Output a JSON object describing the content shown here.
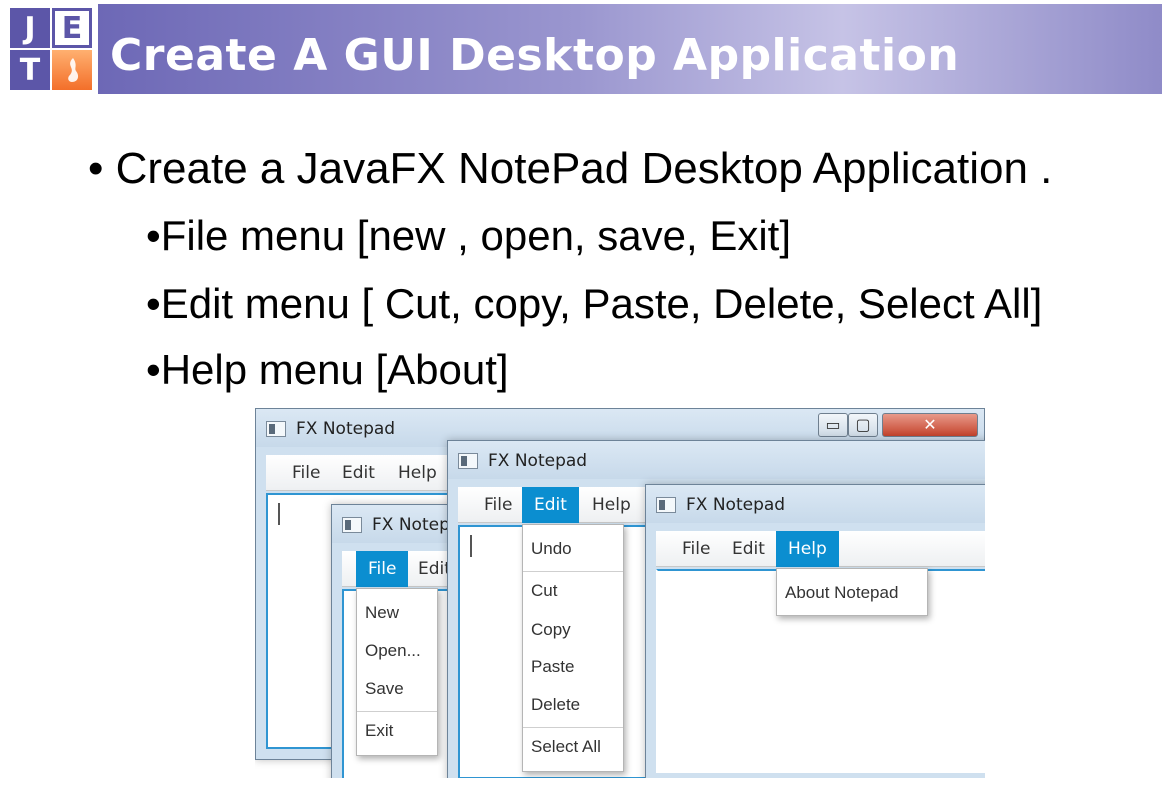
{
  "slide": {
    "logo": {
      "letters": [
        "J",
        "E",
        "T"
      ],
      "flame_icon": "flame-icon"
    },
    "title": "Create A GUI Desktop Application",
    "colors": {
      "banner_start": "#6d68b6",
      "banner_mid": "#c6c3e6",
      "accent": "#0b8ed0"
    }
  },
  "bullets": [
    "• Create a JavaFX NotePad Desktop Application .",
    "•File menu [new , open, save, Exit]",
    "•Edit menu [ Cut, copy, Paste, Delete, Select All]",
    "•Help menu [About]"
  ],
  "screenshot": {
    "window1": {
      "title": "FX Notepad",
      "menus": [
        "File",
        "Edit",
        "Help"
      ],
      "controls": {
        "minimize": "▭",
        "maximize": "▢",
        "close": "✕"
      }
    },
    "window2": {
      "title": "FX Notepad",
      "menus": [
        "File",
        "Edit"
      ],
      "active_menu": "File",
      "file_items": [
        "New",
        "Open...",
        "Save",
        "Exit"
      ]
    },
    "window3": {
      "title": "FX Notepad",
      "menus": [
        "File",
        "Edit",
        "Help"
      ],
      "active_menu": "Edit",
      "edit_items": [
        "Undo",
        "Cut",
        "Copy",
        "Paste",
        "Delete",
        "Select All"
      ]
    },
    "window4": {
      "title": "FX Notepad",
      "menus": [
        "File",
        "Edit",
        "Help"
      ],
      "active_menu": "Help",
      "help_items": [
        "About Notepad"
      ]
    }
  }
}
